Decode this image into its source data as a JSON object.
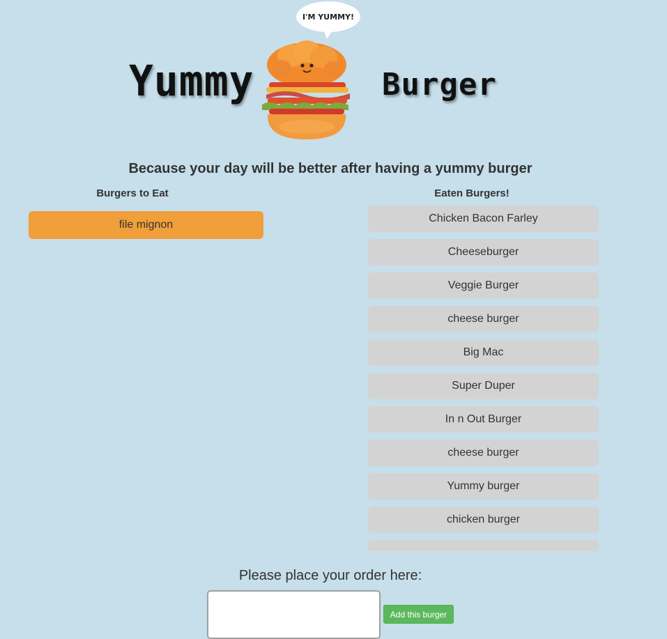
{
  "header": {
    "title_left": "Yummy",
    "title_right": "Burger",
    "speech_bubble": "I'M YUMMY!"
  },
  "tagline": "Because your day will be better after having a yummy burger",
  "to_eat": {
    "heading": "Burgers to Eat",
    "items": [
      "file mignon"
    ]
  },
  "eaten": {
    "heading": "Eaten Burgers!",
    "items": [
      "Chicken Bacon Farley",
      "Cheeseburger",
      "Veggie Burger",
      "cheese burger",
      "Big Mac",
      "Super Duper",
      "In n Out Burger",
      "cheese burger",
      "Yummy burger",
      "chicken burger",
      ""
    ]
  },
  "order": {
    "label": "Please place your order here:",
    "input_value": "",
    "button_label": "Add this burger"
  },
  "colors": {
    "background": "#c6dfea",
    "to_eat_item": "#f19f3a",
    "eaten_item": "#d3d3d3",
    "button": "#5cb85c"
  }
}
